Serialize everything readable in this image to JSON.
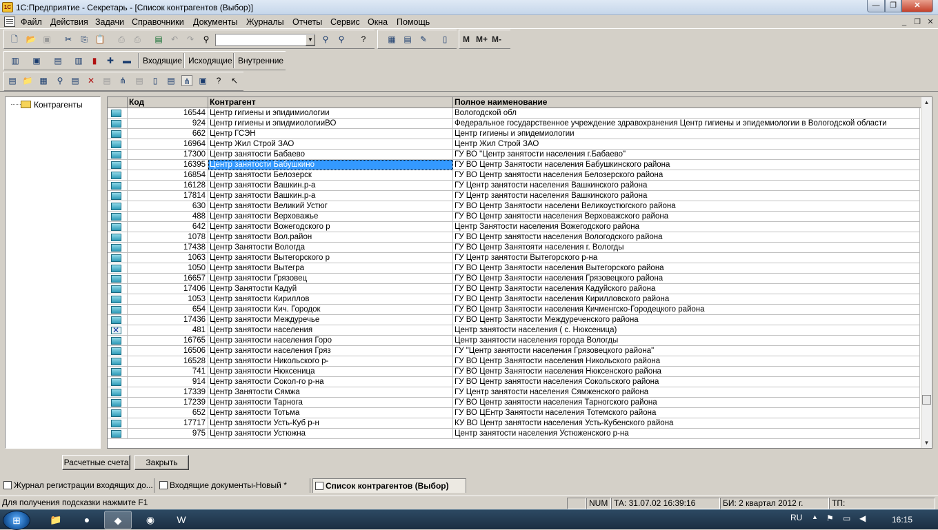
{
  "window": {
    "title": "1С:Предприятие - Секретарь - [Список контрагентов (Выбор)]"
  },
  "menu": [
    "Файл",
    "Действия",
    "Задачи",
    "Справочники",
    "Документы",
    "Журналы",
    "Отчеты",
    "Сервис",
    "Окна",
    "Помощь"
  ],
  "toolbar2": {
    "incoming": "Входящие",
    "outgoing": "Исходящие",
    "internal": "Внутренние"
  },
  "memory": {
    "m": "M",
    "mplus": "M+",
    "mminus": "M-"
  },
  "tree": {
    "root_label": "Контрагенты"
  },
  "table": {
    "headers": {
      "code": "Код",
      "contractor": "Контрагент",
      "fullname": "Полное наименование"
    },
    "rows": [
      {
        "code": "16544",
        "name": "Центр гигиены и эпидимиологии",
        "full": "Вологодской обл"
      },
      {
        "code": "924",
        "name": "Центр гигиены и эпидмиологииВО",
        "full": "Федеральное государственное учреждение здравохранения Центр гигиены и эпидемиологии в Вологодской области"
      },
      {
        "code": "662",
        "name": "Центр ГСЭН",
        "full": "Центр гигиены и эпидемиологии"
      },
      {
        "code": "16964",
        "name": "Центр Жил Строй ЗАО",
        "full": "Центр Жил Строй ЗАО"
      },
      {
        "code": "17300",
        "name": "Центр занятости Бабаево",
        "full": "ГУ ВО \"Центр занятости населения г.Бабаево\""
      },
      {
        "code": "16395",
        "name": "Центр занятости Бабушкино",
        "full": "ГУ ВО Центр Занятости населения Бабушкинского района"
      },
      {
        "code": "16854",
        "name": "Центр занятости Белозерск",
        "full": "ГУ ВО Центр занятости населения Белозерского района"
      },
      {
        "code": "16128",
        "name": "Центр занятости Вашкин.р-а",
        "full": "ГУ Центр занятости населения Вашкинского района"
      },
      {
        "code": "17814",
        "name": "Центр занятости Вашкин.р-а",
        "full": "ГУ Центр занятости населения Вашкинского района"
      },
      {
        "code": "630",
        "name": "Центр занятости Великий Устюг",
        "full": "ГУ ВО Центр Занятости населени Великоустюгского района"
      },
      {
        "code": "488",
        "name": "Центр занятости Верховажье",
        "full": "ГУ ВО Центр занятости населения Верховажского района"
      },
      {
        "code": "642",
        "name": "Центр занятости Вожегодского р",
        "full": "Центр Занятости населения Вожегодского района"
      },
      {
        "code": "1078",
        "name": "Центр занятости Вол.район",
        "full": "ГУ ВО Центр занятости населения Вологодского района"
      },
      {
        "code": "17438",
        "name": "Центр Занятости Вологда",
        "full": "ГУ ВО Центр Занятояти населения г. Вологды"
      },
      {
        "code": "1063",
        "name": "Центр занятости Вытегорского р",
        "full": "ГУ Центр занятости Вытегорского р-на"
      },
      {
        "code": "1050",
        "name": "Центр занятости Вытегра",
        "full": "ГУ ВО Центр Занятости населения Вытегорского района"
      },
      {
        "code": "16657",
        "name": "Центр занятости Грязовец",
        "full": "ГУ ВО Центр Занятости населения Грязовецкого района"
      },
      {
        "code": "17406",
        "name": "Центр Занятости Кадуй",
        "full": "ГУ ВО Центр Занятости населения Кадуйского района"
      },
      {
        "code": "1053",
        "name": "Центр занятости Кириллов",
        "full": "ГУ ВО Центр Занятости населения Кирилловского района"
      },
      {
        "code": "654",
        "name": "Центр занятости Кич. Городок",
        "full": "ГУ ВО Центр Занятости населения Кичменгско-Городецкого района"
      },
      {
        "code": "17436",
        "name": "Центр занятости Междуречье",
        "full": "ГУ ВО Центр Занятости Междуреченского района"
      },
      {
        "code": "481",
        "name": "Центр занятости населения",
        "full": "Центр занятости населения ( с. Нюксеница)"
      },
      {
        "code": "16765",
        "name": "Центр занятости населения Горо",
        "full": "Центр занятости населения города Вологды"
      },
      {
        "code": "16506",
        "name": "Центр занятости населения Гряз",
        "full": "ГУ \"Центр занятости населения Грязовецкого района\""
      },
      {
        "code": "16528",
        "name": "Центр занятости Никольского р-",
        "full": "ГУ ВО Центр Занятости населения Никольского района"
      },
      {
        "code": "741",
        "name": "Центр занятости Нюксеница",
        "full": "ГУ ВО Центр Занятости населения Нюксенского района"
      },
      {
        "code": "914",
        "name": "Центр занятости Сокол-го р-на",
        "full": "ГУ ВО Центр занятости населения Сокольского района"
      },
      {
        "code": "17339",
        "name": "Центр Занятости Сямжа",
        "full": "ГУ Центр занятости населения Сямженского района"
      },
      {
        "code": "17239",
        "name": "Центр занятости Тарнога",
        "full": "ГУ ВО Центр занятости населения Тарногского района"
      },
      {
        "code": "652",
        "name": "Центр занятости Тотьма",
        "full": "ГУ ВО ЦЕнтр Занятости населения Тотемского района"
      },
      {
        "code": "17717",
        "name": "Центр занятости Усть-Куб р-н",
        "full": "КУ ВО Центр занятости населения Усть-Кубенского района"
      },
      {
        "code": "975",
        "name": "Центр занятости Устюжна",
        "full": "Центр занятости населения Устюженского р-на"
      }
    ],
    "selected_index": 5,
    "deleted_index": 21
  },
  "buttons": {
    "accounts": "Расчетные счета",
    "close": "Закрыть"
  },
  "tabs": [
    "Журнал регистрации входящих до...",
    "Входящие документы-Новый *",
    "Список контрагентов (Выбор)"
  ],
  "status": {
    "hint": "Для получения подсказки нажмите F1",
    "num": "NUM",
    "ta": "ТА: 31.07.02  16:39:16",
    "bi": "БИ: 2 квартал 2012 г.",
    "tp": "ТП:"
  },
  "taskbar": {
    "lang": "RU",
    "clock": "16:15"
  },
  "colors": {
    "selection": "#3399ff",
    "chrome": "#d4d0c8"
  }
}
